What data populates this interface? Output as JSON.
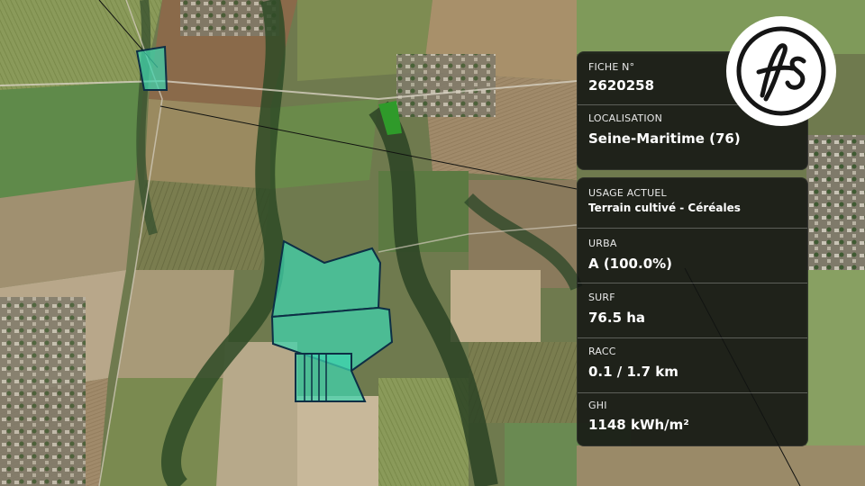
{
  "brand": {
    "logo_text": "fs"
  },
  "map": {
    "view": "satellite",
    "parcel_color": "#3fd6b0",
    "parcel_stroke": "#0d2f45"
  },
  "panel_top": {
    "fiche": {
      "label": "FICHE N°",
      "value": "2620258"
    },
    "localisation": {
      "label": "LOCALISATION",
      "value": "Seine-Maritime (76)"
    }
  },
  "panel_main": {
    "usage": {
      "label": "USAGE ACTUEL",
      "value": "Terrain cultivé - Céréales"
    },
    "urba": {
      "label": "URBA",
      "value": "A (100.0%)"
    },
    "surf": {
      "label": "SURF",
      "value": "76.5 ha"
    },
    "racc": {
      "label": "RACC",
      "value": "0.1 / 1.7 km"
    },
    "ghi": {
      "label": "GHI",
      "value": "1148 kWh/m²"
    }
  }
}
